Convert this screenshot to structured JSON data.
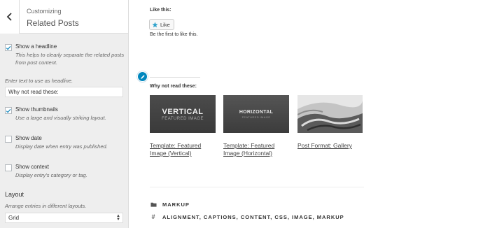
{
  "sidebar": {
    "header": {
      "crumb": "Customizing",
      "title": "Related Posts"
    },
    "show_headline": {
      "label": "Show a headline",
      "checked": true,
      "description": "This helps to clearly separate the related posts from post content."
    },
    "headline_input": {
      "description": "Enter text to use as headline.",
      "value": "Why not read these:"
    },
    "show_thumbnails": {
      "label": "Show thumbnails",
      "checked": true,
      "description": "Use a large and visually striking layout."
    },
    "show_date": {
      "label": "Show date",
      "checked": false,
      "description": "Display date when entry was published."
    },
    "show_context": {
      "label": "Show context",
      "checked": false,
      "description": "Display entry's category or tag."
    },
    "layout": {
      "title": "Layout",
      "description": "Arrange entries in different layouts.",
      "selected": "Grid"
    }
  },
  "preview": {
    "like": {
      "heading": "Like this:",
      "button_label": "Like",
      "note": "Be the first to like this."
    },
    "related": {
      "headline": "Why not read these:",
      "posts": [
        {
          "thumb_title": "VERTICAL",
          "thumb_subtitle": "FEATURED IMAGE",
          "link": "Template: Featured Image (Vertical)"
        },
        {
          "thumb_title": "HORIZONTAL",
          "thumb_subtitle": "FEATURED IMAGE",
          "link": "Template: Featured Image (Horizontal)"
        },
        {
          "link": "Post Format: Gallery"
        }
      ]
    },
    "meta": {
      "categories": "MARKUP",
      "tags": "ALIGNMENT, CAPTIONS, CONTENT, CSS, IMAGE, MARKUP"
    }
  },
  "colors": {
    "accent": "#0087be",
    "checkmark": "#1e8cbe",
    "sidebar_bg": "#eeeeee"
  },
  "icons": [
    "chevron-left-icon",
    "checkmark-icon",
    "star-icon",
    "pencil-icon",
    "folder-icon",
    "hash-icon",
    "select-arrows-icon"
  ]
}
